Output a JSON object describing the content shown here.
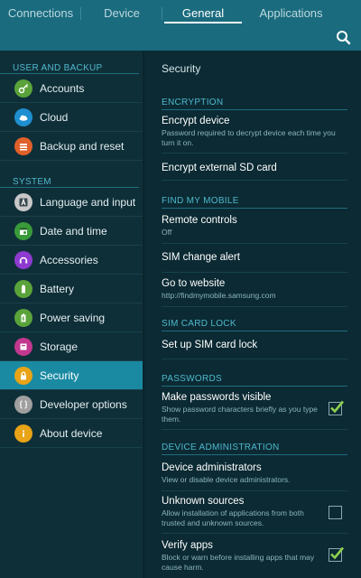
{
  "tabs": [
    {
      "label": "Connections"
    },
    {
      "label": "Device"
    },
    {
      "label": "General",
      "active": true
    },
    {
      "label": "Applications"
    }
  ],
  "left_panel": {
    "sections": [
      {
        "header": "USER AND BACKUP",
        "items": [
          {
            "label": "Accounts",
            "icon": "key-icon",
            "color": "#5aa33a"
          },
          {
            "label": "Cloud",
            "icon": "cloud-icon",
            "color": "#1e8fd0"
          },
          {
            "label": "Backup and reset",
            "icon": "backup-icon",
            "color": "#e0602a"
          }
        ]
      },
      {
        "header": "SYSTEM",
        "items": [
          {
            "label": "Language and input",
            "icon": "language-icon",
            "color": "#c8c8c8"
          },
          {
            "label": "Date and time",
            "icon": "calendar-icon",
            "color": "#3a9a3a"
          },
          {
            "label": "Accessories",
            "icon": "accessories-icon",
            "color": "#8e3ad0"
          },
          {
            "label": "Battery",
            "icon": "battery-icon",
            "color": "#5aa33a"
          },
          {
            "label": "Power saving",
            "icon": "power-saving-icon",
            "color": "#5aa33a"
          },
          {
            "label": "Storage",
            "icon": "storage-icon",
            "color": "#c2388f"
          },
          {
            "label": "Security",
            "icon": "lock-icon",
            "color": "#e8a317",
            "selected": true
          },
          {
            "label": "Developer options",
            "icon": "braces-icon",
            "color": "#a0a0a0"
          },
          {
            "label": "About device",
            "icon": "info-icon",
            "color": "#e8a317"
          }
        ]
      }
    ]
  },
  "right_panel": {
    "title": "Security",
    "encryption_header": "ENCRYPTION",
    "encrypt_device": {
      "label": "Encrypt device",
      "sub": "Password required to decrypt device each time you turn it on."
    },
    "encrypt_sd": {
      "label": "Encrypt external SD card"
    },
    "find_my_mobile_header": "FIND MY MOBILE",
    "remote_controls": {
      "label": "Remote controls",
      "sub": "Off"
    },
    "sim_change_alert": {
      "label": "SIM change alert"
    },
    "go_to_website": {
      "label": "Go to website",
      "sub": "http://findmymobile.samsung.com"
    },
    "sim_card_lock_header": "SIM CARD LOCK",
    "set_up_sim_lock": {
      "label": "Set up SIM card lock"
    },
    "passwords_header": "PASSWORDS",
    "make_passwords_visible": {
      "label": "Make passwords visible",
      "sub": "Show password characters briefly as you type them.",
      "checked": true
    },
    "device_admin_header": "DEVICE ADMINISTRATION",
    "device_administrators": {
      "label": "Device administrators",
      "sub": "View or disable device administrators."
    },
    "unknown_sources": {
      "label": "Unknown sources",
      "sub": "Allow installation of applications from both trusted and unknown sources.",
      "checked": false
    },
    "verify_apps": {
      "label": "Verify apps",
      "sub": "Block or warn before installing apps that may cause harm.",
      "checked": true
    }
  }
}
